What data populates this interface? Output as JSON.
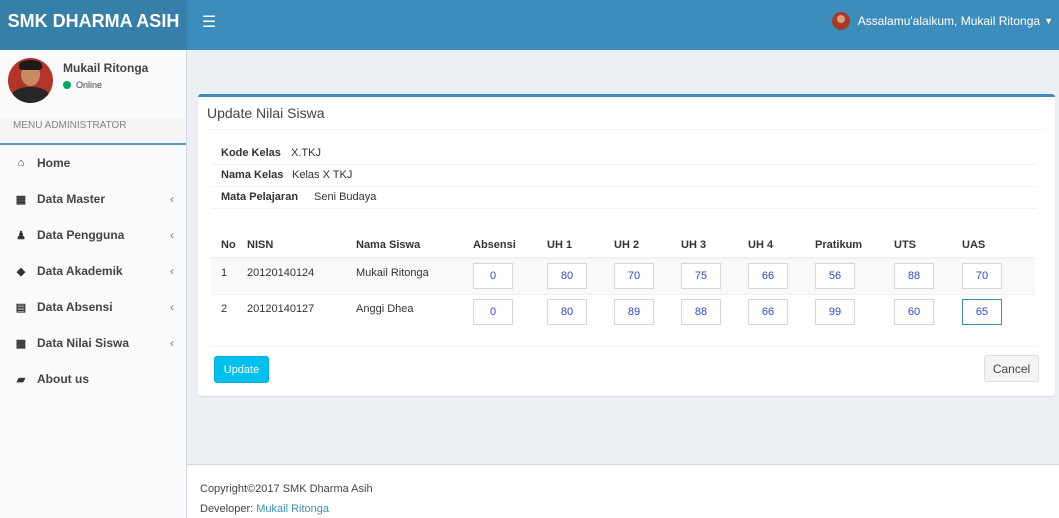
{
  "header": {
    "brand": "SMK DHARMA ASIH",
    "toggle_icon": "☰",
    "greeting": "Assalamu'alaikum, Mukail Ritonga",
    "colors": {
      "header": "#3c8dbc",
      "brand": "#367fa9",
      "accent": "#00c0ef"
    }
  },
  "sidebar": {
    "user_name": "Mukail Ritonga",
    "status": "Online",
    "menu_header": "MENU ADMINISTRATOR",
    "items": [
      {
        "label": "Home",
        "icon": "home-icon",
        "glyph": "⌂",
        "has_children": false
      },
      {
        "label": "Data Master",
        "icon": "grid-icon",
        "glyph": "▦",
        "has_children": true
      },
      {
        "label": "Data Pengguna",
        "icon": "user-icon",
        "glyph": "♟",
        "has_children": true
      },
      {
        "label": "Data Akademik",
        "icon": "tag-icon",
        "glyph": "◆",
        "has_children": true
      },
      {
        "label": "Data Absensi",
        "icon": "calendar-icon",
        "glyph": "▤",
        "has_children": true
      },
      {
        "label": "Data Nilai Siswa",
        "icon": "th-large-icon",
        "glyph": "▩",
        "has_children": true
      },
      {
        "label": "About us",
        "icon": "book-icon",
        "glyph": "▰",
        "has_children": false
      }
    ],
    "chevron": "‹"
  },
  "form": {
    "title": "Update Nilai Siswa",
    "info": [
      {
        "label": "Kode Kelas",
        "value": "X.TKJ"
      },
      {
        "label": "Nama Kelas",
        "value": "Kelas X TKJ"
      },
      {
        "label": "Mata Pelajaran",
        "value": "Seni Budaya"
      }
    ],
    "columns": [
      "No",
      "NISN",
      "Nama Siswa",
      "Absensi",
      "UH 1",
      "UH 2",
      "UH 3",
      "UH 4",
      "Pratikum",
      "UTS",
      "UAS"
    ],
    "rows": [
      {
        "no": "1",
        "nisn": "20120140124",
        "nama": "Mukail Ritonga",
        "absensi": "0",
        "uh1": "80",
        "uh2": "70",
        "uh3": "75",
        "uh4": "66",
        "pratikum": "56",
        "uts": "88",
        "uas": "70"
      },
      {
        "no": "2",
        "nisn": "20120140127",
        "nama": "Anggi Dhea",
        "absensi": "0",
        "uh1": "80",
        "uh2": "89",
        "uh3": "88",
        "uh4": "66",
        "pratikum": "99",
        "uts": "60",
        "uas": "65"
      }
    ],
    "update_label": "Update",
    "cancel_label": "Cancel"
  },
  "footer": {
    "copyright": "Copyright©2017 SMK Dharma Asih",
    "developer_label": "Developer:",
    "developer_name": "Mukail Ritonga"
  }
}
